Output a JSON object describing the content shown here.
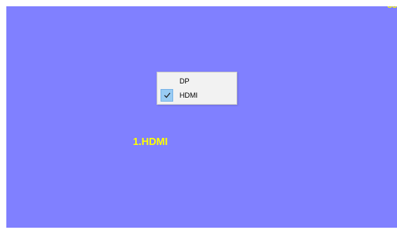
{
  "screen": {
    "background_color": "#8080ff",
    "corner_text": "88",
    "source_label": "1.HDMI",
    "label_color": "#ffff00"
  },
  "input_menu": {
    "items": [
      {
        "label": "DP",
        "checked": false
      },
      {
        "label": "HDMI",
        "checked": true
      }
    ],
    "check_icon": "checkmark-icon"
  }
}
